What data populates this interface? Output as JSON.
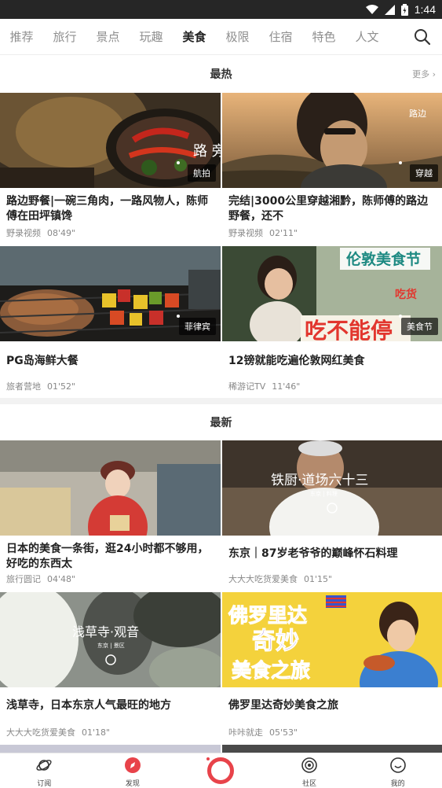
{
  "status_bar": {
    "time": "1:44",
    "icons": [
      "wifi-icon",
      "signal-icon",
      "battery-icon"
    ]
  },
  "tabs": [
    {
      "label": "推荐"
    },
    {
      "label": "旅行"
    },
    {
      "label": "景点"
    },
    {
      "label": "玩趣"
    },
    {
      "label": "美食",
      "active": true
    },
    {
      "label": "极限"
    },
    {
      "label": "住宿"
    },
    {
      "label": "特色"
    },
    {
      "label": "人文"
    }
  ],
  "sections": {
    "hot": {
      "title": "最热",
      "more": "更多"
    },
    "new": {
      "title": "最新"
    }
  },
  "hot_cards": [
    {
      "title": "路边野餐|一碗三角肉，一路风物人，陈师傅在田坪镇馋",
      "source": "野录视频",
      "duration": "08'49\"",
      "badge": "航拍"
    },
    {
      "title": "完结|3000公里穿越湘黔，陈师傅的路边野餐，还不",
      "source": "野录视频",
      "duration": "02'11\"",
      "badge": "穿越"
    },
    {
      "title": "PG岛海鲜大餐",
      "source": "旅者营地",
      "duration": "01'52\"",
      "badge": "菲律宾"
    },
    {
      "title": "12镑就能吃遍伦敦网红美食",
      "source": "稀游记TV",
      "duration": "11'46\"",
      "badge": "美食节"
    }
  ],
  "new_cards": [
    {
      "title": "日本的美食一条街，逛24小时都不够用，好吃的东西太",
      "source": "旅行圆记",
      "duration": "04'48\""
    },
    {
      "title": "东京｜87岁老爷爷的巅峰怀石料理",
      "source": "大大大吃货爱美食",
      "duration": "01'15\""
    },
    {
      "title": "浅草寺，日本东京人气最旺的地方",
      "source": "大大大吃货爱美食",
      "duration": "01'18\""
    },
    {
      "title": "佛罗里达奇妙美食之旅",
      "source": "咔咔就走",
      "duration": "05'53\""
    }
  ],
  "thumb_text": {
    "hot1": "路\n旁",
    "hot4_top": "伦敦美食节",
    "hot4_mid": "吃不能停",
    "hot4_tag": "吃货",
    "new2_title": "铁厨·道场六十三",
    "new2_sub": "东京 | 料理",
    "new3_title": "浅草寺·观音",
    "new3_sub": "东京 | 景区",
    "new4_line1": "佛罗里达",
    "new4_line2": "奇妙",
    "new4_line3": "美食之旅"
  },
  "bottom_nav": [
    {
      "label": "订阅",
      "icon": "planet-icon"
    },
    {
      "label": "发现",
      "icon": "discover-icon"
    },
    {
      "label": "",
      "icon": "record-ring-icon"
    },
    {
      "label": "社区",
      "icon": "community-icon"
    },
    {
      "label": "我的",
      "icon": "smile-icon"
    }
  ],
  "colors": {
    "accent": "#e8434a",
    "active_tab": "#222222",
    "inactive_tab": "#8f8f8f"
  }
}
